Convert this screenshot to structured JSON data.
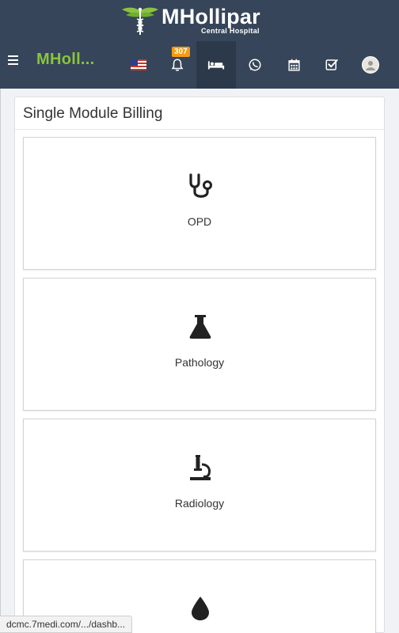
{
  "header": {
    "logo_text": "MHollipar",
    "logo_sub": "Central Hospital",
    "brand": "MHoll...",
    "notifications_count": "307",
    "icons": [
      "menu-icon",
      "us-flag-icon",
      "bell-icon",
      "bed-icon",
      "whatsapp-icon",
      "calendar-icon",
      "checkbox-icon",
      "avatar"
    ]
  },
  "panel": {
    "title": "Single Module Billing",
    "modules": [
      {
        "label": "OPD",
        "icon": "stethoscope-icon"
      },
      {
        "label": "Pathology",
        "icon": "flask-icon"
      },
      {
        "label": "Radiology",
        "icon": "microscope-icon"
      },
      {
        "label": "",
        "icon": "blood-drop-icon"
      }
    ]
  },
  "status": {
    "url": "dcmc.7medi.com/.../dashb..."
  },
  "colors": {
    "topbar": "#364559",
    "brand_green": "#8ac43f",
    "badge": "#f39c12"
  }
}
